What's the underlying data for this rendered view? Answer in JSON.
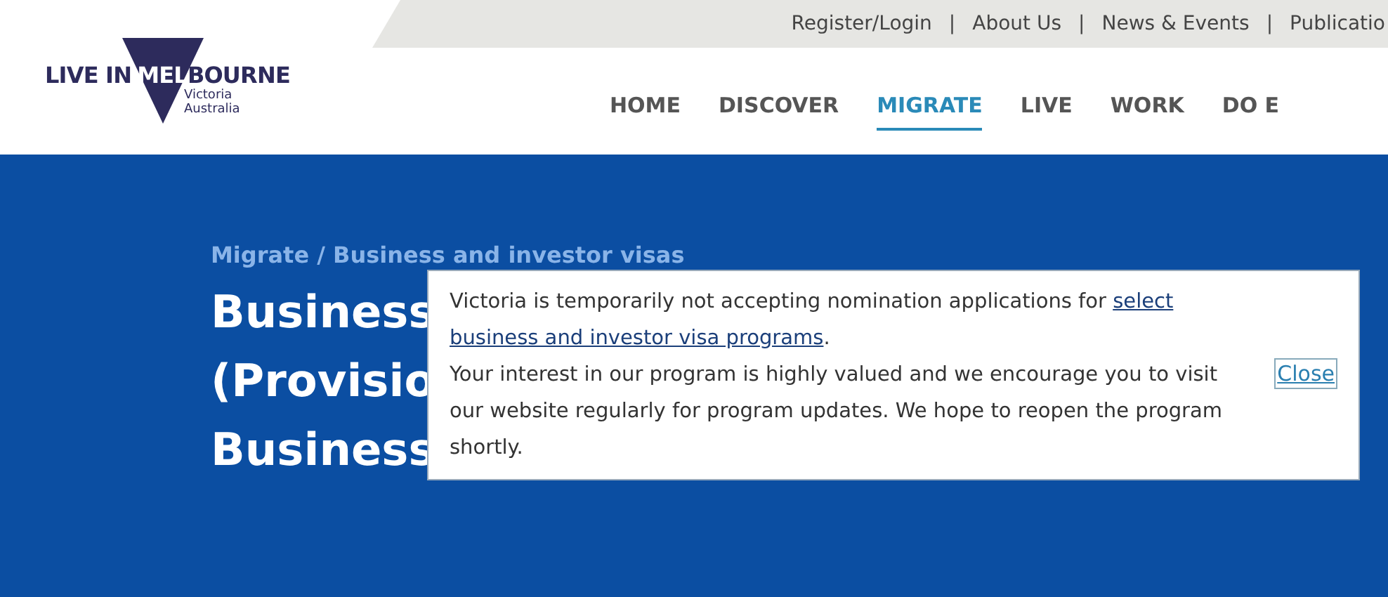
{
  "logo": {
    "word_1": "LIVE IN",
    "word_2": "MEL",
    "word_3": "BOURNE",
    "line_1": "Victoria",
    "line_2": "Australia"
  },
  "top_links": {
    "separator": "|",
    "items": [
      "Register/Login",
      "About Us",
      "News & Events",
      "Publicatio"
    ]
  },
  "nav": [
    {
      "label": "HOME",
      "selected": false
    },
    {
      "label": "DISCOVER",
      "selected": false
    },
    {
      "label": "MIGRATE",
      "selected": true
    },
    {
      "label": "LIVE",
      "selected": false
    },
    {
      "label": "WORK",
      "selected": false
    },
    {
      "label": "DO E",
      "selected": false
    }
  ],
  "breadcrumb": "Migrate / Business and investor visas",
  "title_lines": [
    "Business",
    "(Provisio",
    "Business"
  ],
  "notice": {
    "text_before": "Victoria is temporarily not accepting nomination applications for ",
    "link_line_1": "select",
    "link_line_2": "business and investor visa programs",
    "text_after": ".",
    "paragraph_2": "Your interest in our program is highly valued and we encourage you to visit our website regularly for program updates. We hope to reopen the program shortly.",
    "close": "Close"
  }
}
